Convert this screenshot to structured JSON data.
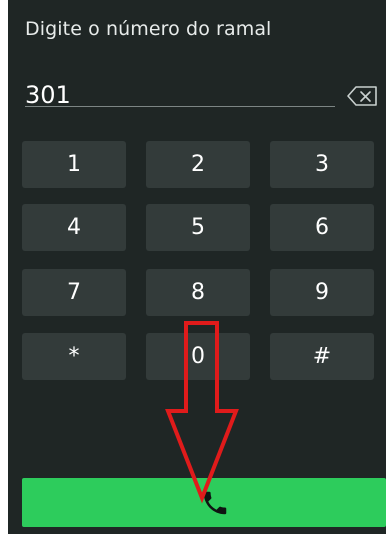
{
  "dialer": {
    "prompt": "Digite o número do ramal",
    "number": "301",
    "backspace_icon": "backspace-icon",
    "keys": [
      "1",
      "2",
      "3",
      "4",
      "5",
      "6",
      "7",
      "8",
      "9",
      "*",
      "0",
      "#"
    ],
    "call_icon": "phone-icon"
  },
  "colors": {
    "background": "#1f2625",
    "key": "#333b3a",
    "call": "#2dcc5c",
    "annotation": "#e01b1b"
  }
}
